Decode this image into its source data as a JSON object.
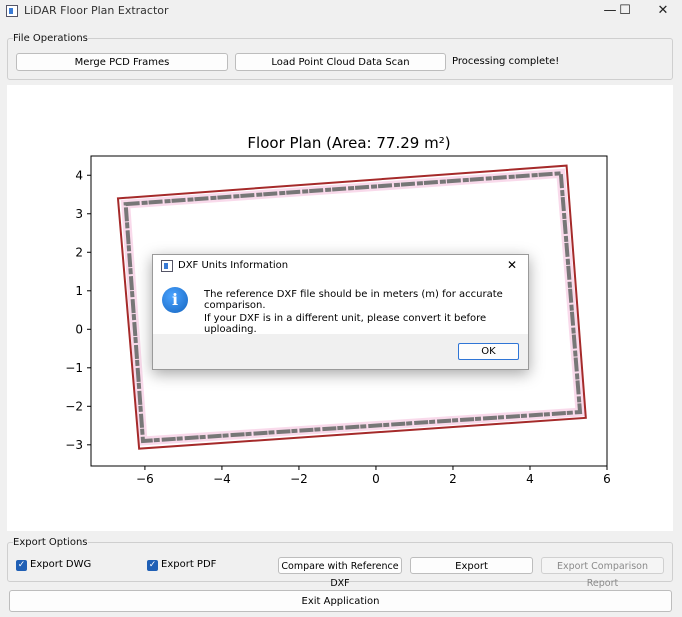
{
  "window": {
    "title": "LiDAR Floor Plan Extractor",
    "minimize": "—",
    "maximize": "☐",
    "close": "✕"
  },
  "file_ops": {
    "label": "File Operations",
    "merge_button": "Merge PCD Frames",
    "load_button": "Load Point Cloud Data Scan",
    "status": "Processing complete!"
  },
  "export_ops": {
    "label": "Export Options",
    "dwg_label": "Export DWG",
    "dwg_checked": true,
    "pdf_label": "Export PDF",
    "pdf_checked": true,
    "compare_button": "Compare with Reference DXF",
    "export_button": "Export",
    "report_button": "Export Comparison Report",
    "exit_button": "Exit Application"
  },
  "dialog": {
    "title": "DXF Units Information",
    "close": "✕",
    "icon": "info-icon",
    "line1": "The reference DXF file should be in meters (m) for accurate comparison.",
    "line2": "If your DXF is in a different unit, please convert it before uploading.",
    "ok": "OK"
  },
  "chart_data": {
    "type": "scatter",
    "title": "Floor Plan (Area: 77.29 m²)",
    "xlim": [
      -7.4,
      6.0
    ],
    "ylim": [
      -3.55,
      4.5
    ],
    "xticks": [
      "−6",
      "−4",
      "−2",
      "0",
      "2",
      "4",
      "6"
    ],
    "xtick_values": [
      -6,
      -4,
      -2,
      0,
      2,
      4,
      6
    ],
    "yticks": [
      "4",
      "3",
      "2",
      "1",
      "0",
      "−1",
      "−2",
      "−3"
    ],
    "ytick_values": [
      4,
      3,
      2,
      1,
      0,
      -1,
      -2,
      -3
    ],
    "grid": false,
    "series": [
      {
        "kind": "fitted-rectangle",
        "color": "#a52a2a",
        "corners": [
          [
            -6.7,
            3.4
          ],
          [
            4.95,
            4.25
          ],
          [
            5.45,
            -2.3
          ],
          [
            -6.15,
            -3.1
          ]
        ]
      },
      {
        "kind": "point-cloud-walls",
        "color": "#777777",
        "corners": [
          [
            -6.5,
            3.25
          ],
          [
            4.8,
            4.05
          ],
          [
            5.3,
            -2.15
          ],
          [
            -6.05,
            -2.9
          ]
        ]
      }
    ],
    "colors": {
      "rectangle": "#a52a2a",
      "points": "#777777",
      "highlight": "#f4b6d8"
    }
  }
}
